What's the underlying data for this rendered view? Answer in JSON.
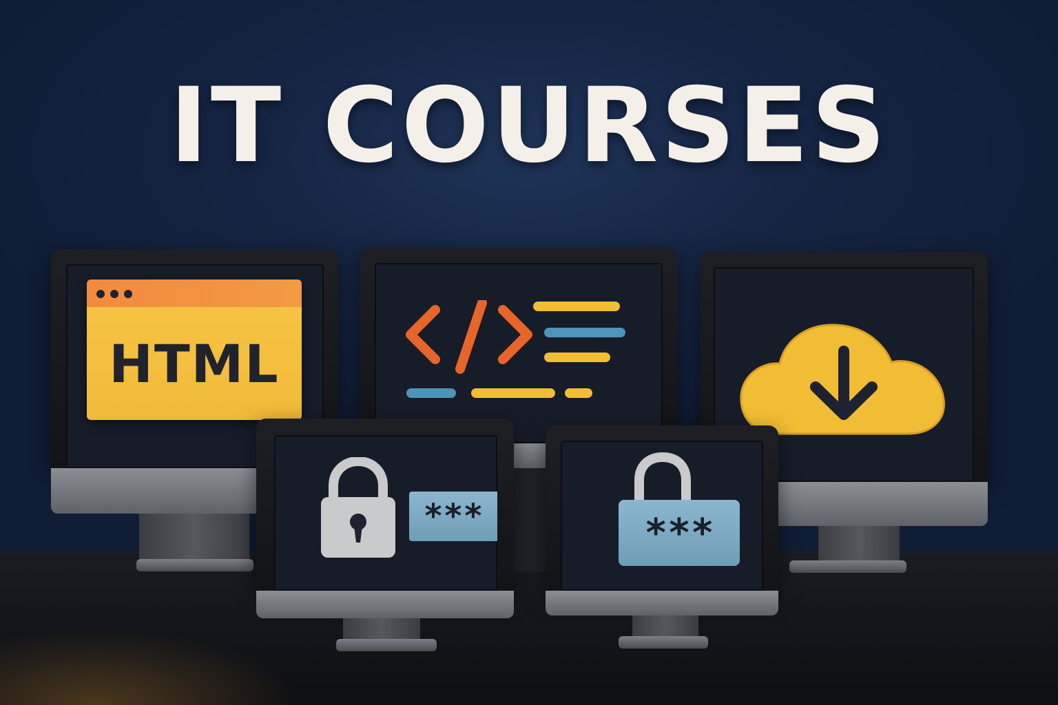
{
  "title": "IT COURSES",
  "html_card": {
    "label": "HTML"
  },
  "password_masked_left": "***",
  "password_masked_right": "***",
  "colors": {
    "background": "#152644",
    "orange": "#f38a3e",
    "yellow": "#f0bd35",
    "blue": "#4f93b8",
    "lock_gray": "#c9cacc"
  },
  "icons": [
    "browser-window-icon",
    "code-brackets-icon",
    "cloud-download-icon",
    "padlock-icon",
    "password-field-icon"
  ]
}
